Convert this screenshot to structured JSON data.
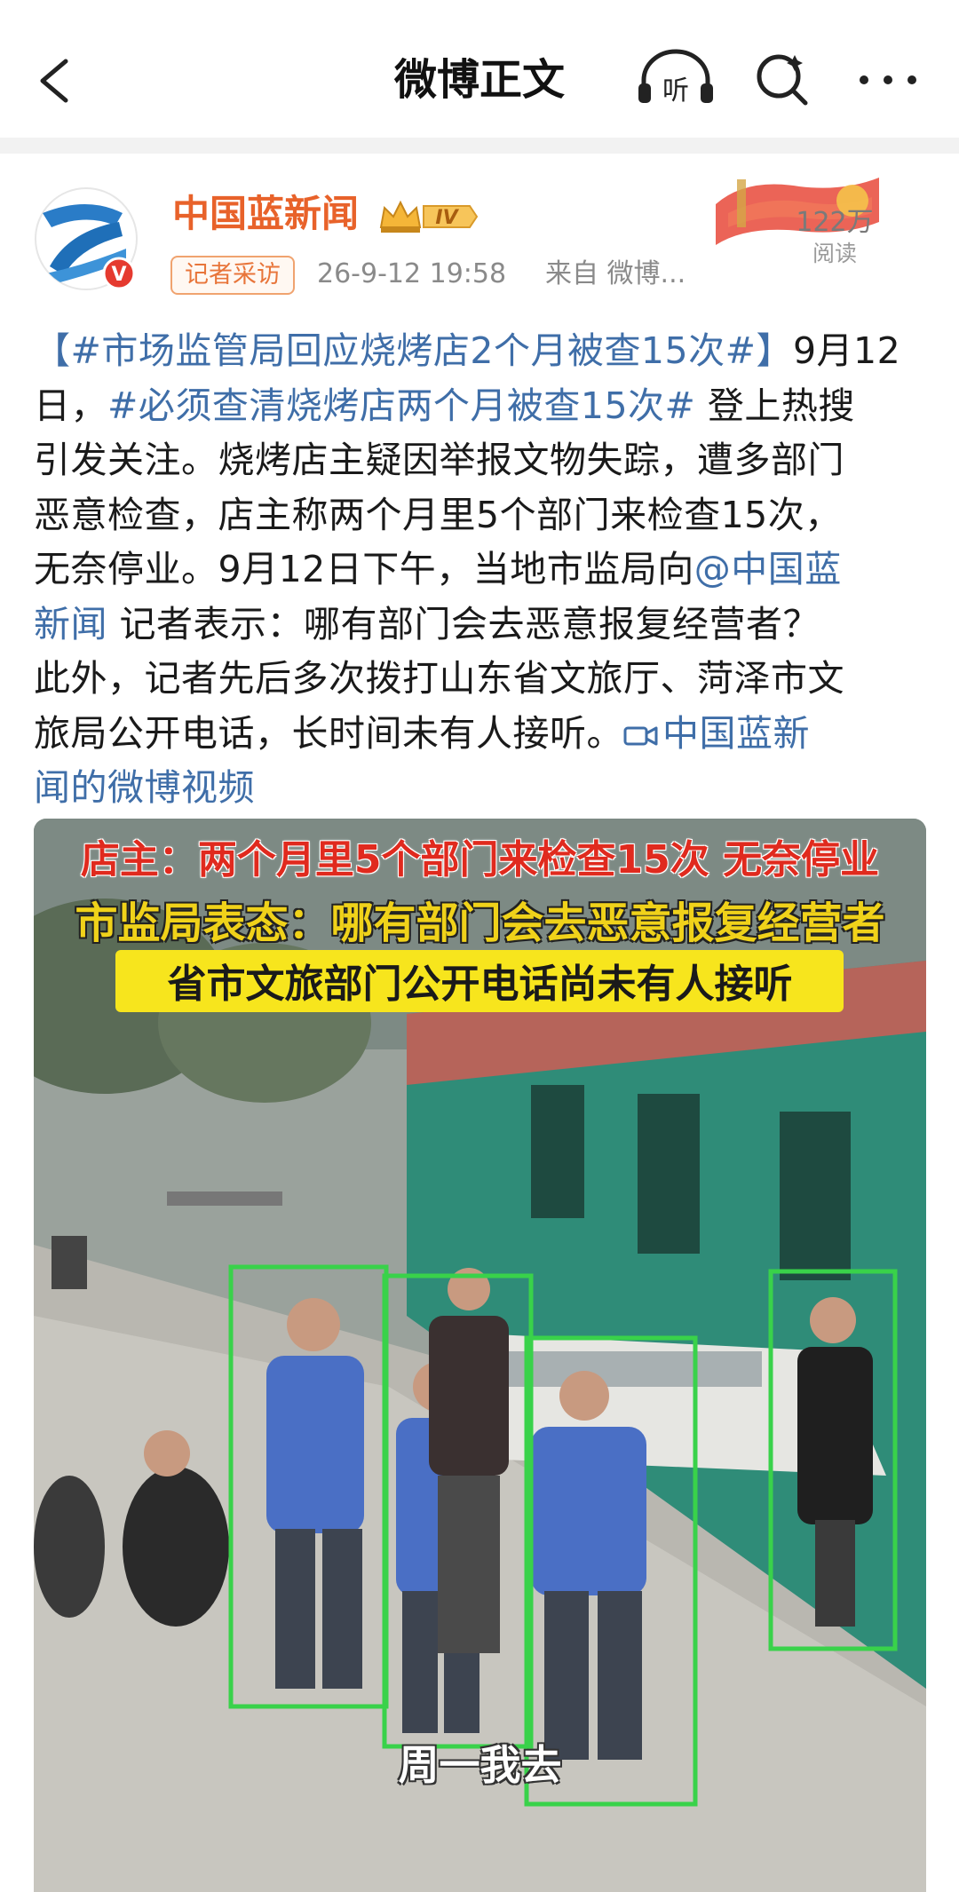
{
  "nav": {
    "title": "微博正文",
    "listen_label": "听"
  },
  "author": {
    "name": "中国蓝新闻",
    "level_badge": "IV",
    "tag": "记者采访",
    "time": "26-9-12 19:58",
    "source": "来自 微博...",
    "read_count": "122万",
    "read_label": "阅读"
  },
  "post": {
    "topic1": "【#市场监管局回应烧烤店2个月被查15次#】",
    "text1a": "9月12",
    "text1b": "日，",
    "topic2": "#必须查清烧烤店两个月被查15次#",
    "text2": " 登上热搜",
    "line3": "引发关注。烧烤店主疑因举报文物失踪，遭多部门",
    "line4": "恶意检查，店主称两个月里5个部门来检查15次，",
    "line5": "无奈停业。9月12日下午，当地市监局向",
    "mention1": "@中国蓝",
    "mention2": "新闻",
    "line6": " 记者表示：哪有部门会去恶意报复经营者？",
    "line7": "此外，记者先后多次拨打山东省文旅厅、菏泽市文",
    "line8": "旅局公开电话，长时间未有人接听。",
    "video_link1": "中国蓝新",
    "video_link2": "闻的微博视频"
  },
  "video": {
    "caption1": "店主：两个月里5个部门来检查15次 无奈停业",
    "caption2": "市监局表态：哪有部门会去恶意报复经营者",
    "caption3": "省市文旅部门公开电话尚未有人接听",
    "subtitle": "周一我去"
  },
  "colors": {
    "author_orange": "#e8622a",
    "link_blue": "#3f6ea8",
    "meta_gray": "#8a8a8a"
  }
}
